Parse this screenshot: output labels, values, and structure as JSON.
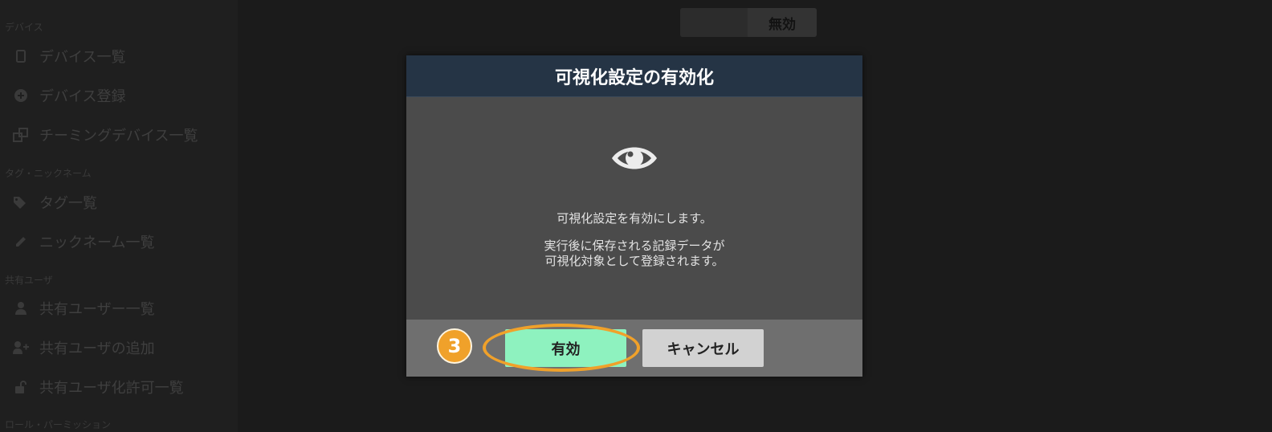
{
  "sidebar": {
    "sections": [
      {
        "label": "デバイス"
      },
      {
        "label": "タグ・ニックネーム"
      },
      {
        "label": "共有ユーザ"
      },
      {
        "label": "ロール・パーミッション"
      }
    ],
    "items": [
      {
        "label": "デバイス一覧",
        "icon": "device-icon"
      },
      {
        "label": "デバイス登録",
        "icon": "plus-circle-icon"
      },
      {
        "label": "チーミングデバイス一覧",
        "icon": "clone-icon"
      },
      {
        "label": "タグ一覧",
        "icon": "tags-icon"
      },
      {
        "label": "ニックネーム一覧",
        "icon": "pencil-icon"
      },
      {
        "label": "共有ユーザー一覧",
        "icon": "user-icon"
      },
      {
        "label": "共有ユーザの追加",
        "icon": "user-plus-icon"
      },
      {
        "label": "共有ユーザ化許可一覧",
        "icon": "unlock-icon"
      }
    ]
  },
  "toggle": {
    "off_label": "無効"
  },
  "modal": {
    "title": "可視化設定の有効化",
    "icon": "eye-icon",
    "message": "可視化設定を有効にします。",
    "detail_line1": "実行後に保存される記録データが",
    "detail_line2": "可視化対象として登録されます。",
    "enable_label": "有効",
    "cancel_label": "キャンセル",
    "step_number": "3"
  },
  "colors": {
    "header_bg": "#253445",
    "enable_button": "#8ef2bf",
    "cancel_button": "#d2d2d2",
    "highlight": "#f0a12a"
  }
}
